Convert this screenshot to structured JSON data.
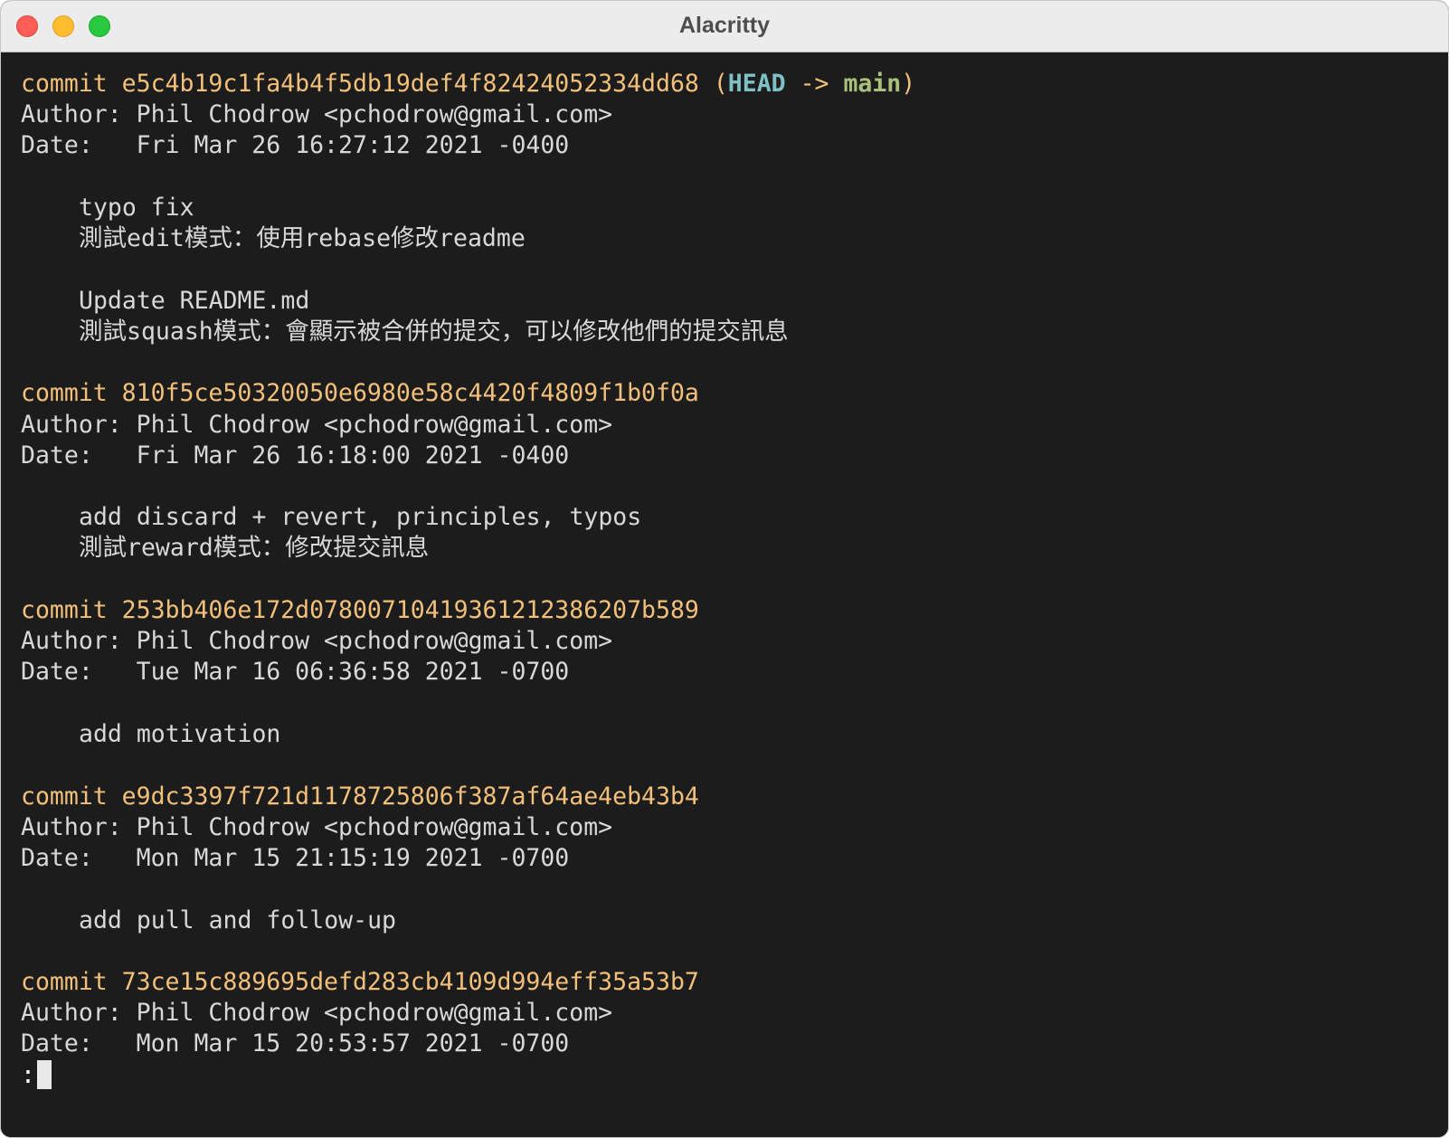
{
  "window": {
    "title": "Alacritty"
  },
  "terminal": {
    "head_ref": {
      "open": " (",
      "head": "HEAD",
      "arrow": " -> ",
      "branch": "main",
      "close": ")"
    },
    "commits": [
      {
        "commit_line": "commit e5c4b19c1fa4b4f5db19def4f82424052334dd68",
        "author_line": "Author: Phil Chodrow <pchodrow@gmail.com>",
        "date_line": "Date:   Fri Mar 26 16:27:12 2021 -0400",
        "message": [
          "typo fix",
          "測試edit模式：使用rebase修改readme",
          "",
          "Update README.md",
          "測試squash模式：會顯示被合併的提交，可以修改他們的提交訊息"
        ]
      },
      {
        "commit_line": "commit 810f5ce50320050e6980e58c4420f4809f1b0f0a",
        "author_line": "Author: Phil Chodrow <pchodrow@gmail.com>",
        "date_line": "Date:   Fri Mar 26 16:18:00 2021 -0400",
        "message": [
          "add discard + revert, principles, typos",
          "測試reward模式：修改提交訊息"
        ]
      },
      {
        "commit_line": "commit 253bb406e172d07800710419361212386207b589",
        "author_line": "Author: Phil Chodrow <pchodrow@gmail.com>",
        "date_line": "Date:   Tue Mar 16 06:36:58 2021 -0700",
        "message": [
          "add motivation"
        ]
      },
      {
        "commit_line": "commit e9dc3397f721d1178725806f387af64ae4eb43b4",
        "author_line": "Author: Phil Chodrow <pchodrow@gmail.com>",
        "date_line": "Date:   Mon Mar 15 21:15:19 2021 -0700",
        "message": [
          "add pull and follow-up"
        ]
      },
      {
        "commit_line": "commit 73ce15c889695defd283cb4109d994eff35a53b7",
        "author_line": "Author: Phil Chodrow <pchodrow@gmail.com>",
        "date_line": "Date:   Mon Mar 15 20:53:57 2021 -0700",
        "message": []
      }
    ],
    "pager_prompt": ":"
  },
  "colors": {
    "background": "#1c1c1c",
    "foreground": "#d8d8d8",
    "commit_hash": "#f2c07a",
    "head_label": "#7ec0c4",
    "branch_label": "#a8c07a"
  }
}
